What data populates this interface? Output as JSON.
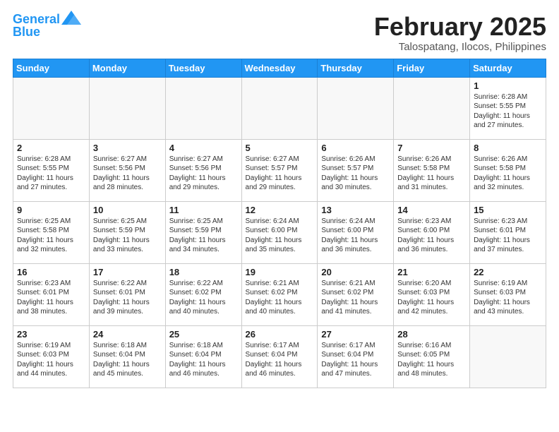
{
  "header": {
    "logo_line1": "General",
    "logo_line2": "Blue",
    "title": "February 2025",
    "subtitle": "Talospatang, Ilocos, Philippines"
  },
  "weekdays": [
    "Sunday",
    "Monday",
    "Tuesday",
    "Wednesday",
    "Thursday",
    "Friday",
    "Saturday"
  ],
  "weeks": [
    [
      {
        "day": "",
        "info": ""
      },
      {
        "day": "",
        "info": ""
      },
      {
        "day": "",
        "info": ""
      },
      {
        "day": "",
        "info": ""
      },
      {
        "day": "",
        "info": ""
      },
      {
        "day": "",
        "info": ""
      },
      {
        "day": "1",
        "info": "Sunrise: 6:28 AM\nSunset: 5:55 PM\nDaylight: 11 hours and 27 minutes."
      }
    ],
    [
      {
        "day": "2",
        "info": "Sunrise: 6:28 AM\nSunset: 5:55 PM\nDaylight: 11 hours and 27 minutes."
      },
      {
        "day": "3",
        "info": "Sunrise: 6:27 AM\nSunset: 5:56 PM\nDaylight: 11 hours and 28 minutes."
      },
      {
        "day": "4",
        "info": "Sunrise: 6:27 AM\nSunset: 5:56 PM\nDaylight: 11 hours and 29 minutes."
      },
      {
        "day": "5",
        "info": "Sunrise: 6:27 AM\nSunset: 5:57 PM\nDaylight: 11 hours and 29 minutes."
      },
      {
        "day": "6",
        "info": "Sunrise: 6:26 AM\nSunset: 5:57 PM\nDaylight: 11 hours and 30 minutes."
      },
      {
        "day": "7",
        "info": "Sunrise: 6:26 AM\nSunset: 5:58 PM\nDaylight: 11 hours and 31 minutes."
      },
      {
        "day": "8",
        "info": "Sunrise: 6:26 AM\nSunset: 5:58 PM\nDaylight: 11 hours and 32 minutes."
      }
    ],
    [
      {
        "day": "9",
        "info": "Sunrise: 6:25 AM\nSunset: 5:58 PM\nDaylight: 11 hours and 32 minutes."
      },
      {
        "day": "10",
        "info": "Sunrise: 6:25 AM\nSunset: 5:59 PM\nDaylight: 11 hours and 33 minutes."
      },
      {
        "day": "11",
        "info": "Sunrise: 6:25 AM\nSunset: 5:59 PM\nDaylight: 11 hours and 34 minutes."
      },
      {
        "day": "12",
        "info": "Sunrise: 6:24 AM\nSunset: 6:00 PM\nDaylight: 11 hours and 35 minutes."
      },
      {
        "day": "13",
        "info": "Sunrise: 6:24 AM\nSunset: 6:00 PM\nDaylight: 11 hours and 36 minutes."
      },
      {
        "day": "14",
        "info": "Sunrise: 6:23 AM\nSunset: 6:00 PM\nDaylight: 11 hours and 36 minutes."
      },
      {
        "day": "15",
        "info": "Sunrise: 6:23 AM\nSunset: 6:01 PM\nDaylight: 11 hours and 37 minutes."
      }
    ],
    [
      {
        "day": "16",
        "info": "Sunrise: 6:23 AM\nSunset: 6:01 PM\nDaylight: 11 hours and 38 minutes."
      },
      {
        "day": "17",
        "info": "Sunrise: 6:22 AM\nSunset: 6:01 PM\nDaylight: 11 hours and 39 minutes."
      },
      {
        "day": "18",
        "info": "Sunrise: 6:22 AM\nSunset: 6:02 PM\nDaylight: 11 hours and 40 minutes."
      },
      {
        "day": "19",
        "info": "Sunrise: 6:21 AM\nSunset: 6:02 PM\nDaylight: 11 hours and 40 minutes."
      },
      {
        "day": "20",
        "info": "Sunrise: 6:21 AM\nSunset: 6:02 PM\nDaylight: 11 hours and 41 minutes."
      },
      {
        "day": "21",
        "info": "Sunrise: 6:20 AM\nSunset: 6:03 PM\nDaylight: 11 hours and 42 minutes."
      },
      {
        "day": "22",
        "info": "Sunrise: 6:19 AM\nSunset: 6:03 PM\nDaylight: 11 hours and 43 minutes."
      }
    ],
    [
      {
        "day": "23",
        "info": "Sunrise: 6:19 AM\nSunset: 6:03 PM\nDaylight: 11 hours and 44 minutes."
      },
      {
        "day": "24",
        "info": "Sunrise: 6:18 AM\nSunset: 6:04 PM\nDaylight: 11 hours and 45 minutes."
      },
      {
        "day": "25",
        "info": "Sunrise: 6:18 AM\nSunset: 6:04 PM\nDaylight: 11 hours and 46 minutes."
      },
      {
        "day": "26",
        "info": "Sunrise: 6:17 AM\nSunset: 6:04 PM\nDaylight: 11 hours and 46 minutes."
      },
      {
        "day": "27",
        "info": "Sunrise: 6:17 AM\nSunset: 6:04 PM\nDaylight: 11 hours and 47 minutes."
      },
      {
        "day": "28",
        "info": "Sunrise: 6:16 AM\nSunset: 6:05 PM\nDaylight: 11 hours and 48 minutes."
      },
      {
        "day": "",
        "info": ""
      }
    ]
  ]
}
